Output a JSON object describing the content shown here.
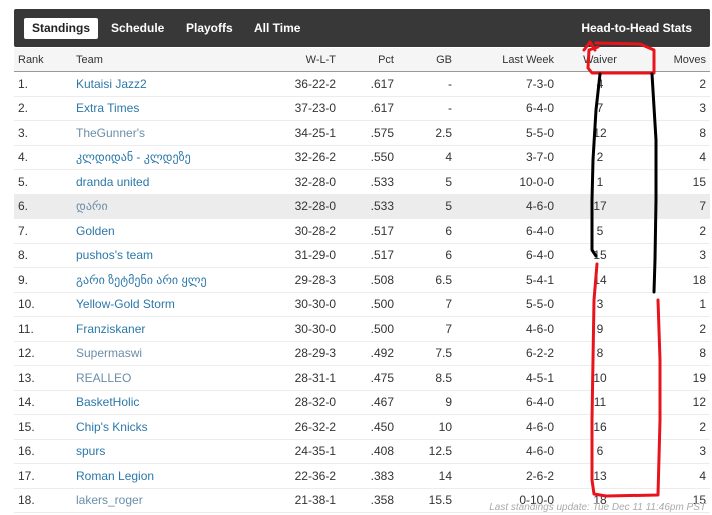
{
  "tabs": {
    "standings": "Standings",
    "schedule": "Schedule",
    "playoffs": "Playoffs",
    "all_time": "All Time",
    "h2h": "Head-to-Head Stats"
  },
  "columns": {
    "rank": "Rank",
    "team": "Team",
    "wlt": "W-L-T",
    "pct": "Pct",
    "gb": "GB",
    "last_week": "Last Week",
    "waiver": "Waiver",
    "moves": "Moves"
  },
  "rows": [
    {
      "rank": "1.",
      "team": "Kutaisi Jazz2",
      "wlt": "36-22-2",
      "pct": ".617",
      "gb": "-",
      "last_week": "7-3-0",
      "waiver": "4",
      "moves": "2",
      "dim": false
    },
    {
      "rank": "2.",
      "team": "Extra Times",
      "wlt": "37-23-0",
      "pct": ".617",
      "gb": "-",
      "last_week": "6-4-0",
      "waiver": "7",
      "moves": "3",
      "dim": false
    },
    {
      "rank": "3.",
      "team": "TheGunner's",
      "wlt": "34-25-1",
      "pct": ".575",
      "gb": "2.5",
      "last_week": "5-5-0",
      "waiver": "12",
      "moves": "8",
      "dim": true
    },
    {
      "rank": "4.",
      "team": "კლდიდან - კლდეზე",
      "wlt": "32-26-2",
      "pct": ".550",
      "gb": "4",
      "last_week": "3-7-0",
      "waiver": "2",
      "moves": "4",
      "dim": false
    },
    {
      "rank": "5.",
      "team": "dranda united",
      "wlt": "32-28-0",
      "pct": ".533",
      "gb": "5",
      "last_week": "10-0-0",
      "waiver": "1",
      "moves": "15",
      "dim": false
    },
    {
      "rank": "6.",
      "team": "დარი",
      "wlt": "32-28-0",
      "pct": ".533",
      "gb": "5",
      "last_week": "4-6-0",
      "waiver": "17",
      "moves": "7",
      "dim": true,
      "highlight": true
    },
    {
      "rank": "7.",
      "team": "Golden",
      "wlt": "30-28-2",
      "pct": ".517",
      "gb": "6",
      "last_week": "6-4-0",
      "waiver": "5",
      "moves": "2",
      "dim": false
    },
    {
      "rank": "8.",
      "team": "pushos's team",
      "wlt": "31-29-0",
      "pct": ".517",
      "gb": "6",
      "last_week": "6-4-0",
      "waiver": "15",
      "moves": "3",
      "dim": false
    },
    {
      "rank": "9.",
      "team": "გარი ზეტმენი არი ყლე",
      "wlt": "29-28-3",
      "pct": ".508",
      "gb": "6.5",
      "last_week": "5-4-1",
      "waiver": "14",
      "moves": "18",
      "dim": false
    },
    {
      "rank": "10.",
      "team": "Yellow-Gold Storm",
      "wlt": "30-30-0",
      "pct": ".500",
      "gb": "7",
      "last_week": "5-5-0",
      "waiver": "3",
      "moves": "1",
      "dim": false
    },
    {
      "rank": "11.",
      "team": "Franziskaner",
      "wlt": "30-30-0",
      "pct": ".500",
      "gb": "7",
      "last_week": "4-6-0",
      "waiver": "9",
      "moves": "2",
      "dim": false
    },
    {
      "rank": "12.",
      "team": "Supermaswi",
      "wlt": "28-29-3",
      "pct": ".492",
      "gb": "7.5",
      "last_week": "6-2-2",
      "waiver": "8",
      "moves": "8",
      "dim": true
    },
    {
      "rank": "13.",
      "team": "REALLEO",
      "wlt": "28-31-1",
      "pct": ".475",
      "gb": "8.5",
      "last_week": "4-5-1",
      "waiver": "10",
      "moves": "19",
      "dim": true
    },
    {
      "rank": "14.",
      "team": "BasketHolic",
      "wlt": "28-32-0",
      "pct": ".467",
      "gb": "9",
      "last_week": "6-4-0",
      "waiver": "11",
      "moves": "12",
      "dim": false
    },
    {
      "rank": "15.",
      "team": "Chip's Knicks",
      "wlt": "26-32-2",
      "pct": ".450",
      "gb": "10",
      "last_week": "4-6-0",
      "waiver": "16",
      "moves": "2",
      "dim": false
    },
    {
      "rank": "16.",
      "team": "spurs",
      "wlt": "24-35-1",
      "pct": ".408",
      "gb": "12.5",
      "last_week": "4-6-0",
      "waiver": "6",
      "moves": "3",
      "dim": false
    },
    {
      "rank": "17.",
      "team": "Roman Legion",
      "wlt": "22-36-2",
      "pct": ".383",
      "gb": "14",
      "last_week": "2-6-2",
      "waiver": "13",
      "moves": "4",
      "dim": false
    },
    {
      "rank": "18.",
      "team": "lakers_roger",
      "wlt": "21-38-1",
      "pct": ".358",
      "gb": "15.5",
      "last_week": "0-10-0",
      "waiver": "18",
      "moves": "15",
      "dim": true
    }
  ],
  "footer": "Last standings update: Tue Dec 11 11:46pm PST",
  "colors": {
    "annotation_red": "#e8141c",
    "annotation_black": "#000000",
    "link": "#2c78a8",
    "topbar": "#383838"
  }
}
